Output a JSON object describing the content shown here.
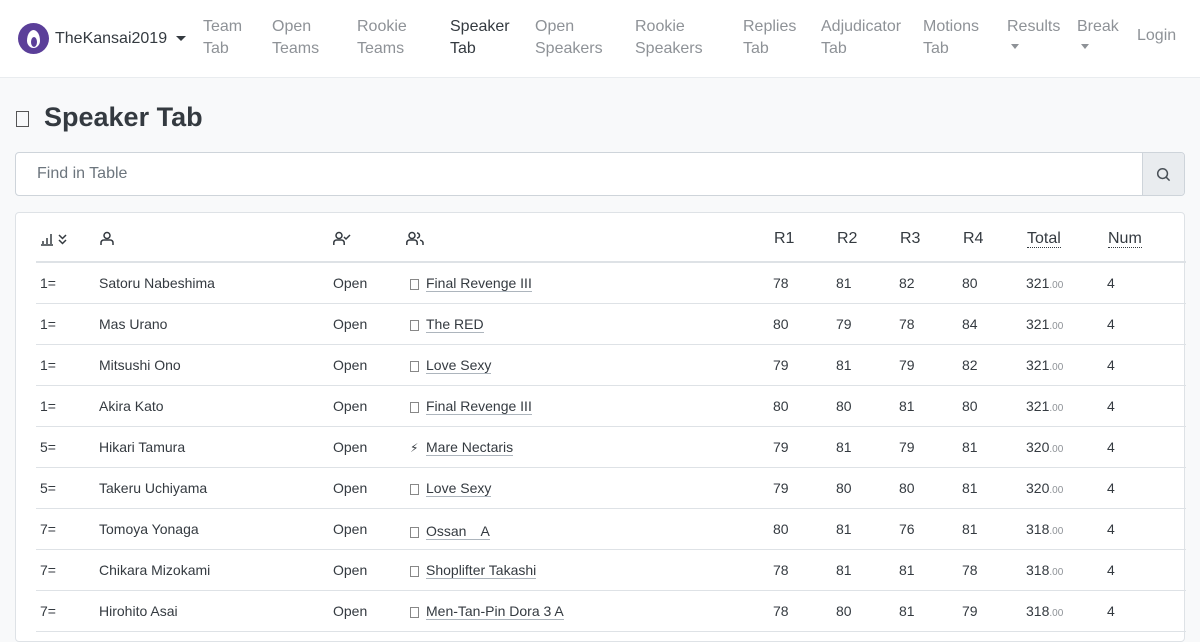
{
  "navbar": {
    "brand": "TheKansai2019",
    "items": [
      {
        "line1": "Team",
        "line2": "Tab",
        "active": false,
        "dropdown": false
      },
      {
        "line1": "Open",
        "line2": "Teams",
        "active": false,
        "dropdown": false
      },
      {
        "line1": "Rookie",
        "line2": "Teams",
        "active": false,
        "dropdown": false
      },
      {
        "line1": "Speaker",
        "line2": "Tab",
        "active": true,
        "dropdown": false
      },
      {
        "line1": "Open",
        "line2": "Speakers",
        "active": false,
        "dropdown": false
      },
      {
        "line1": "Rookie",
        "line2": "Speakers",
        "active": false,
        "dropdown": false
      },
      {
        "line1": "Replies",
        "line2": "Tab",
        "active": false,
        "dropdown": false
      },
      {
        "line1": "Adjudicator",
        "line2": "Tab",
        "active": false,
        "dropdown": false
      },
      {
        "line1": "Motions",
        "line2": "Tab",
        "active": false,
        "dropdown": false
      },
      {
        "line1": "Results",
        "line2": "",
        "active": false,
        "dropdown": true
      },
      {
        "line1": "Break",
        "line2": "",
        "active": false,
        "dropdown": true
      }
    ],
    "login": "Login"
  },
  "page": {
    "title": "Speaker Tab"
  },
  "search": {
    "placeholder": "Find in Table"
  },
  "table": {
    "headers": {
      "r1": "R1",
      "r2": "R2",
      "r3": "R3",
      "r4": "R4",
      "total": "Total",
      "num": "Num"
    },
    "rows": [
      {
        "rank": "1=",
        "name": "Satoru Nabeshima",
        "category": "Open",
        "team": "Final Revenge III",
        "team_icon": "box",
        "r1": "78",
        "r2": "81",
        "r3": "82",
        "r4": "80",
        "total": "321",
        "total_dec": ".00",
        "num": "4"
      },
      {
        "rank": "1=",
        "name": "Mas Urano",
        "category": "Open",
        "team": "The RED",
        "team_icon": "box",
        "r1": "80",
        "r2": "79",
        "r3": "78",
        "r4": "84",
        "total": "321",
        "total_dec": ".00",
        "num": "4"
      },
      {
        "rank": "1=",
        "name": "Mitsushi Ono",
        "category": "Open",
        "team": "Love Sexy",
        "team_icon": "box",
        "r1": "79",
        "r2": "81",
        "r3": "79",
        "r4": "82",
        "total": "321",
        "total_dec": ".00",
        "num": "4"
      },
      {
        "rank": "1=",
        "name": "Akira Kato",
        "category": "Open",
        "team": "Final Revenge III",
        "team_icon": "box",
        "r1": "80",
        "r2": "80",
        "r3": "81",
        "r4": "80",
        "total": "321",
        "total_dec": ".00",
        "num": "4"
      },
      {
        "rank": "5=",
        "name": "Hikari Tamura",
        "category": "Open",
        "team": "Mare Nectaris",
        "team_icon": "bolt",
        "r1": "79",
        "r2": "81",
        "r3": "79",
        "r4": "81",
        "total": "320",
        "total_dec": ".00",
        "num": "4"
      },
      {
        "rank": "5=",
        "name": "Takeru Uchiyama",
        "category": "Open",
        "team": "Love Sexy",
        "team_icon": "box",
        "r1": "79",
        "r2": "80",
        "r3": "80",
        "r4": "81",
        "total": "320",
        "total_dec": ".00",
        "num": "4"
      },
      {
        "rank": "7=",
        "name": "Tomoya Yonaga",
        "category": "Open",
        "team": "Ossan　A",
        "team_icon": "box",
        "r1": "80",
        "r2": "81",
        "r3": "76",
        "r4": "81",
        "total": "318",
        "total_dec": ".00",
        "num": "4"
      },
      {
        "rank": "7=",
        "name": "Chikara Mizokami",
        "category": "Open",
        "team": "Shoplifter Takashi",
        "team_icon": "box",
        "r1": "78",
        "r2": "81",
        "r3": "81",
        "r4": "78",
        "total": "318",
        "total_dec": ".00",
        "num": "4"
      },
      {
        "rank": "7=",
        "name": "Hirohito Asai",
        "category": "Open",
        "team": "Men-Tan-Pin Dora 3 A",
        "team_icon": "box",
        "r1": "78",
        "r2": "80",
        "r3": "81",
        "r4": "79",
        "total": "318",
        "total_dec": ".00",
        "num": "4"
      }
    ]
  }
}
